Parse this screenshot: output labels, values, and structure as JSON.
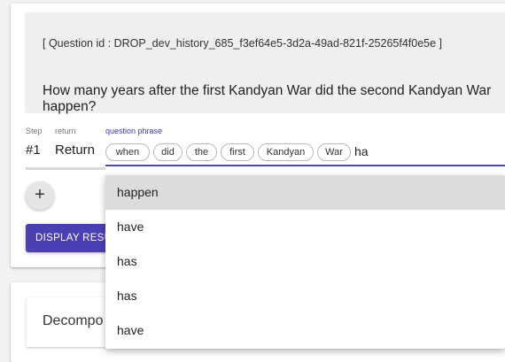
{
  "question": {
    "id_line": "[ Question id : DROP_dev_history_685_f3ef64e5-3d2a-49ad-821f-25265f4f0e5e ]",
    "text": "How many years after the first Kandyan War did the second Kandyan War happen?"
  },
  "step": {
    "step_label": "Step",
    "return_label": "return",
    "phrase_label": "question phrase",
    "number": "#1",
    "return_value": "Return",
    "chips": [
      "when",
      "did",
      "the",
      "first",
      "Kandyan",
      "War"
    ],
    "input_value": "ha"
  },
  "buttons": {
    "add": "+",
    "display": "DISPLAY RESU"
  },
  "decomposition": {
    "title": "Decompo"
  },
  "dropdown": {
    "options": [
      "happen",
      "have",
      "has",
      "has",
      "have"
    ],
    "selected_index": 0
  }
}
